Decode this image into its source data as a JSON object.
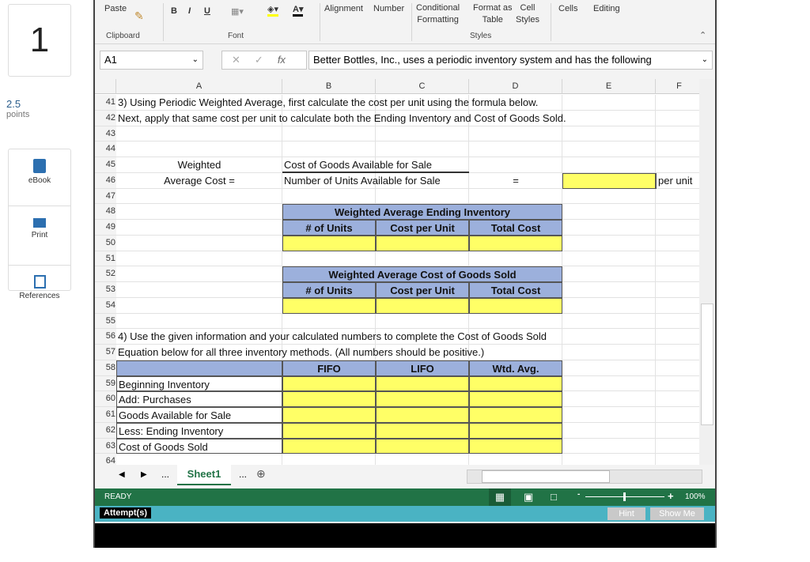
{
  "question": {
    "number": "1",
    "points": "2.5",
    "points_label": "points"
  },
  "tools": [
    {
      "label": "eBook",
      "icon": "book-icon"
    },
    {
      "label": "Print",
      "icon": "printer-icon"
    },
    {
      "label": "References",
      "icon": "copy-icon"
    }
  ],
  "ribbon": {
    "paste": "Paste",
    "clipboard": "Clipboard",
    "bold": "B",
    "italic": "I",
    "underline": "U",
    "font": "Font",
    "alignment": "Alignment",
    "number": "Number",
    "conditional": "Conditional",
    "formatting": "Formatting",
    "format_as": "Format as",
    "table": "Table",
    "cell": "Cell",
    "styles_btn": "Styles",
    "styles": "Styles",
    "cells": "Cells",
    "editing": "Editing",
    "fill_color": "#ffff00",
    "font_color": "#000000"
  },
  "formula_bar": {
    "name_box": "A1",
    "fx": "fx",
    "content": "Better Bottles, Inc., uses a periodic inventory system and has the following"
  },
  "columns": [
    "A",
    "B",
    "C",
    "D",
    "E",
    "F"
  ],
  "rows": [
    "41",
    "42",
    "43",
    "44",
    "45",
    "46",
    "47",
    "48",
    "49",
    "50",
    "51",
    "52",
    "53",
    "54",
    "55",
    "56",
    "57",
    "58",
    "59",
    "60",
    "61",
    "62",
    "63",
    "64"
  ],
  "cells": {
    "r41": "3) Using Periodic Weighted Average, first calculate the cost per unit using the formula below.",
    "r42": "Next, apply that same cost per unit to calculate both the Ending Inventory and Cost of Goods Sold.",
    "weighted": "Weighted",
    "avg_cost": "Average Cost  =",
    "numerator": "Cost of Goods Available for Sale",
    "denominator": "Number of Units Available for Sale",
    "equals": "=",
    "per_unit": "per unit",
    "ei_title": "Weighted Average Ending Inventory",
    "cogs_title": "Weighted Average Cost of Goods Sold",
    "units": "# of Units",
    "cpu": "Cost per Unit",
    "total": "Total Cost",
    "r56": "4) Use the given information and your calculated numbers to complete the Cost of Goods Sold",
    "r57": "Equation below for all three inventory methods. (All numbers should be positive.)",
    "fifo": "FIFO",
    "lifo": "LIFO",
    "wtd": "Wtd. Avg.",
    "labels": [
      "Beginning Inventory",
      "Add: Purchases",
      "Goods Available for Sale",
      "Less:  Ending Inventory",
      "Cost of Goods Sold"
    ]
  },
  "sheet_tab": "Sheet1",
  "status": {
    "ready": "READY",
    "zoom": "100%"
  },
  "footer": {
    "attempts": "Attempt(s)",
    "hint": "Hint",
    "show_me": "Show Me"
  },
  "colors": {
    "excel_green": "#217346",
    "header_blue": "#9cb0dc",
    "input_yellow": "#ffff66",
    "teal": "#4ab3c3"
  }
}
